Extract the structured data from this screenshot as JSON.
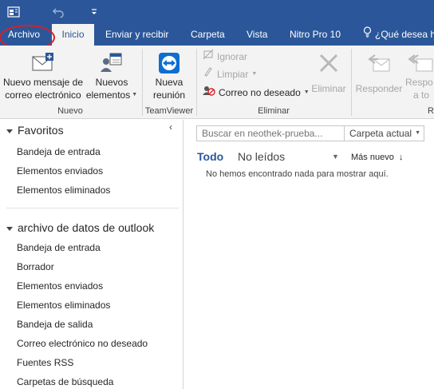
{
  "quick_access": {
    "app_icon": "outlook-quick-access-icon",
    "undo_icon": "undo-icon",
    "customize_icon": "customize-toolbar-icon"
  },
  "tabs": {
    "file": "Archivo",
    "home": "Inicio",
    "send_receive": "Enviar y recibir",
    "folder": "Carpeta",
    "view": "Vista",
    "nitro": "Nitro Pro 10",
    "tell_me": "¿Qué desea ha"
  },
  "ribbon": {
    "new_email_l1": "Nuevo mensaje de",
    "new_email_l2": "correo electrónico",
    "new_items_l1": "Nuevos",
    "new_items_l2": "elementos",
    "group_new": "Nuevo",
    "new_meeting_l1": "Nueva",
    "new_meeting_l2": "reunión",
    "group_teamviewer": "TeamViewer",
    "ignore": "Ignorar",
    "cleanup": "Limpiar",
    "junk": "Correo no deseado",
    "delete": "Eliminar",
    "group_delete": "Eliminar",
    "reply": "Responder",
    "reply_all_l1": "Respo",
    "reply_all_l2": "a to",
    "group_respond": "R"
  },
  "nav": {
    "favorites_title": "Favoritos",
    "favorites": [
      "Bandeja de entrada",
      "Elementos enviados",
      "Elementos eliminados"
    ],
    "datafile_title": "archivo de datos de outlook",
    "folders": [
      "Bandeja de entrada",
      "Borrador",
      "Elementos enviados",
      "Elementos eliminados",
      "Bandeja de salida",
      "Correo electrónico no deseado",
      "Fuentes RSS",
      "Carpetas de búsqueda"
    ]
  },
  "list": {
    "search_placeholder": "Buscar en neothek-prueba...",
    "search_scope": "Carpeta actual",
    "filter_all": "Todo",
    "filter_unread": "No leídos",
    "sort": "Más nuevo",
    "empty_message": "No hemos encontrado nada para mostrar aquí."
  },
  "colors": {
    "accent": "#2b579a",
    "highlight_ring": "#d4202a"
  }
}
